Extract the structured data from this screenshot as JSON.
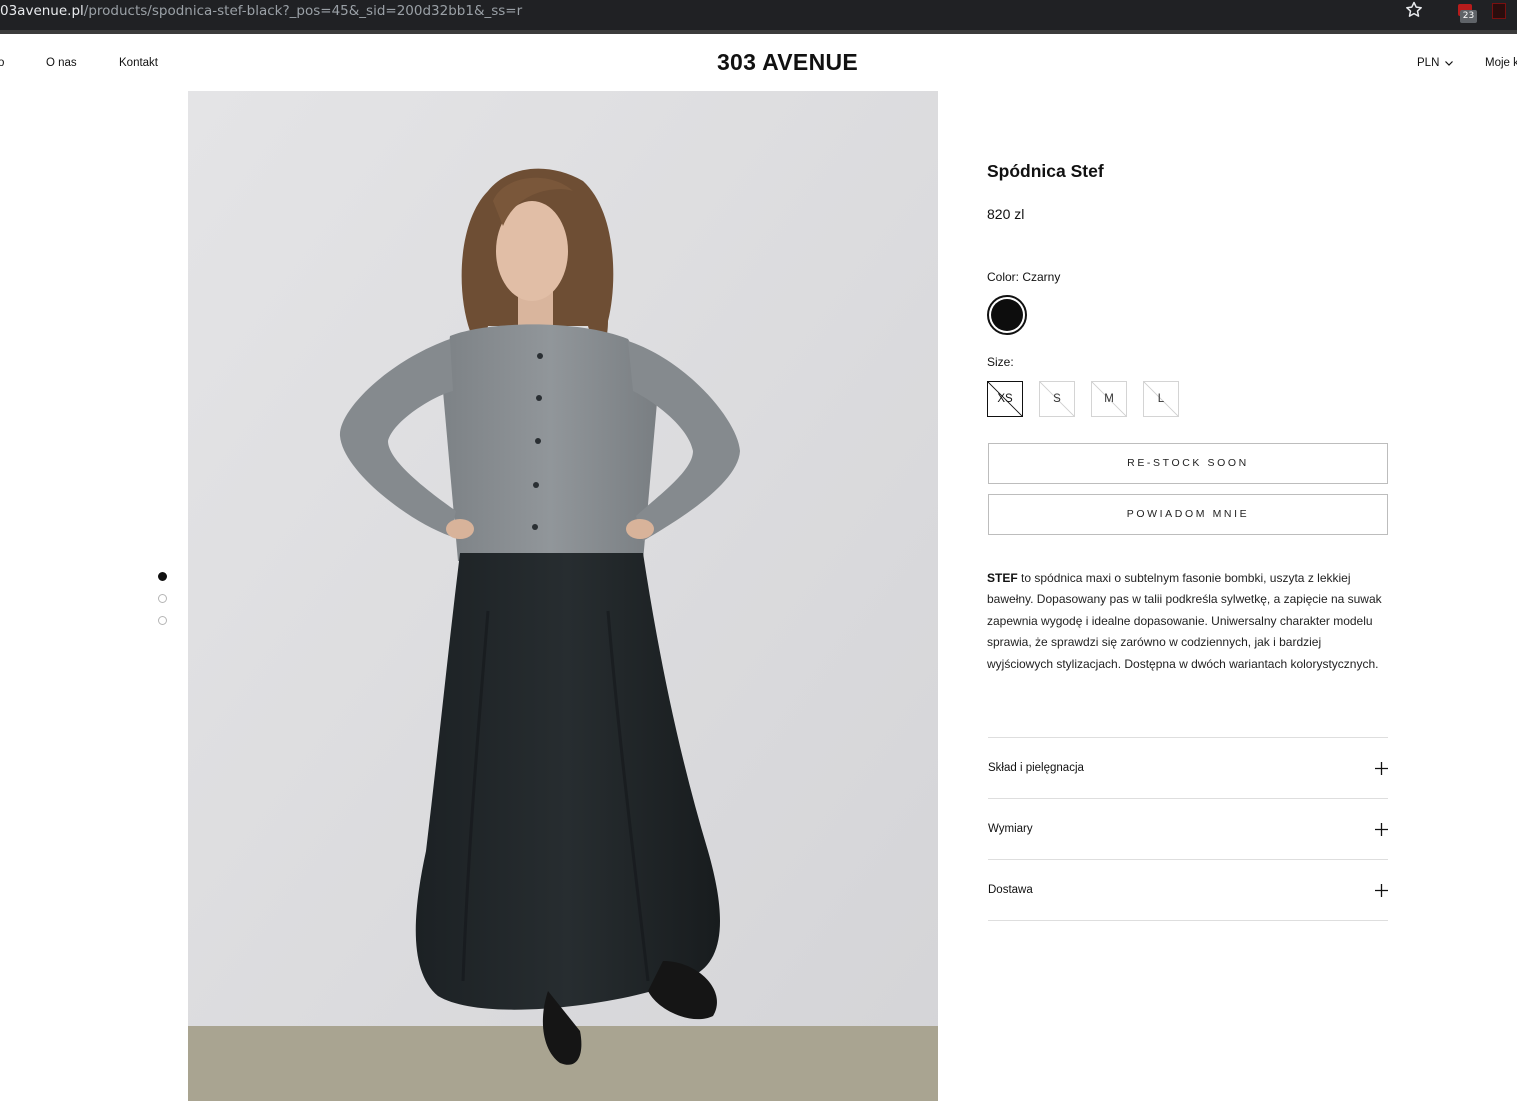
{
  "browser": {
    "url_host": "03avenue.pl",
    "url_path": "/products/spodnica-stef-black?_pos=45&_sid=200d32bb1&_ss=r",
    "extension_badge": "23"
  },
  "header": {
    "nav_partial": "o",
    "nav_about": "O nas",
    "nav_contact": "Kontakt",
    "logo": "303 AVENUE",
    "currency": "PLN",
    "account_partial": "Moje k"
  },
  "product": {
    "title": "Spódnica Stef",
    "price": "820 zl",
    "color_label": "Color: Czarny",
    "color_swatch": "#0d0d0d",
    "size_label": "Size:",
    "sizes": [
      "XS",
      "S",
      "M",
      "L"
    ],
    "selected_size": "XS",
    "restock_button": "RE-STOCK SOON",
    "notify_button": "POWIADOM MNIE",
    "description_bold": "STEF",
    "description_rest": " to spódnica maxi o subtelnym fasonie bombki, uszyta z lekkiej bawełny. Dopasowany pas w talii podkreśla sylwetkę, a zapięcie na suwak zapewnia wygodę i idealne dopasowanie. Uniwersalny charakter modelu sprawia, że sprawdzi się zarówno w codziennych, jak i bardziej wyjściowych stylizacjach. Dostępna w dwóch wariantach kolorystycznych.",
    "accordion": [
      "Skład i pielęgnacja",
      "Wymiary",
      "Dostawa"
    ]
  },
  "gallery": {
    "image_count": 3,
    "active_index": 0
  }
}
